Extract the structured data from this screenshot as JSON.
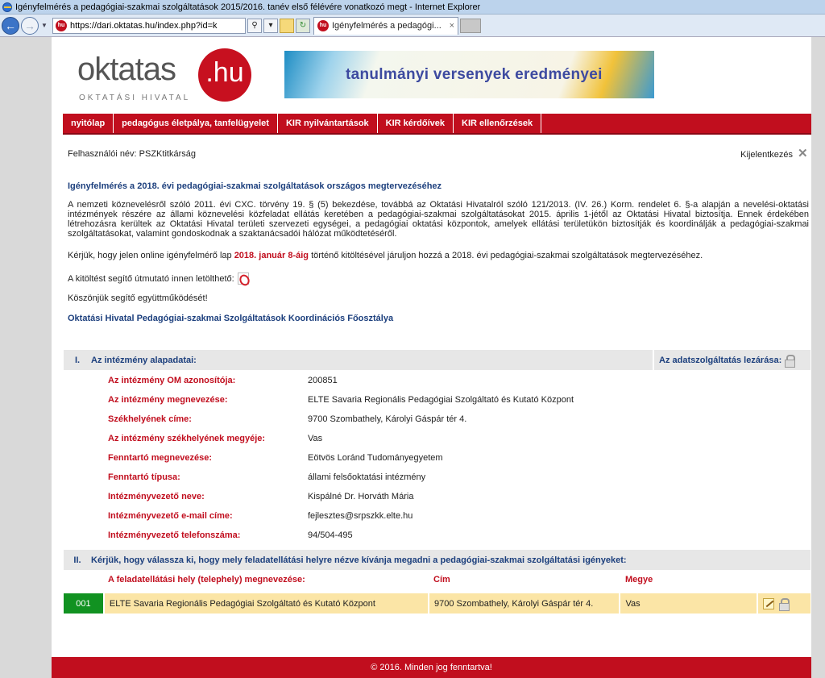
{
  "browser": {
    "window_title": "Igényfelmérés a pedagógiai-szakmai szolgáltatások 2015/2016. tanév első félévére vonatkozó megt - Internet Explorer",
    "url": "https://dari.oktatas.hu/index.php?id=k",
    "tab_title": "Igényfelmérés a pedagógi...",
    "favicon_text": "hu",
    "tab_close": "×"
  },
  "logo": {
    "word": "oktatas",
    "hu": ".hu",
    "subtitle": "OKTATÁSI HIVATAL"
  },
  "banner": {
    "text": "tanulmányi versenyek eredményei"
  },
  "menu": [
    {
      "label": "nyitólap"
    },
    {
      "label": "pedagógus életpálya, tanfelügyelet"
    },
    {
      "label": "KIR nyilvántartások"
    },
    {
      "label": "KIR kérdőívek"
    },
    {
      "label": "KIR ellenőrzések"
    }
  ],
  "user": {
    "label": "Felhasználói név: PSZKtitkárság",
    "logout": "Kijelentkezés"
  },
  "content": {
    "heading": "Igényfelmérés a 2018. évi pedagógiai-szakmai szolgáltatások országos megtervezéséhez",
    "para1": "A nemzeti köznevelésről szóló 2011. évi CXC. törvény 19. § (5) bekezdése, továbbá az Oktatási Hivatalról szóló 121/2013. (IV. 26.) Korm. rendelet 6. §-a alapján a nevelési-oktatási intézmények részére az állami köznevelési közfeladat ellátás keretében a pedagógiai-szakmai szolgáltatásokat 2015. április 1-jétől az Oktatási Hivatal biztosítja. Ennek érdekében létrehozásra kerültek az Oktatási Hivatal területi szervezeti egységei, a pedagógiai oktatási központok, amelyek ellátási területükön biztosítják és koordinálják a pedagógiai-szakmai szolgáltatásokat, valamint gondoskodnak a szaktanácsadói hálózat működtetéséről.",
    "para2_pre": "Kérjük, hogy jelen online igényfelmérő lap ",
    "para2_highlight": "2018. január 8-áig",
    "para2_post": " történő kitöltésével járuljon hozzá a 2018. évi pedagógiai-szakmai szolgáltatások megtervezéséhez.",
    "para3": "A kitöltést segítő útmutató innen letölthető:",
    "para4": "Köszönjük segítő együttműködését!",
    "signature": "Oktatási Hivatal Pedagógiai-szakmai Szolgáltatások Koordinációs Főosztálya"
  },
  "section1": {
    "num": "I.",
    "title": "Az intézmény alapadatai:",
    "right": "Az adatszolgáltatás lezárása:",
    "fields": [
      {
        "label": "Az intézmény OM azonosítója:",
        "value": "200851"
      },
      {
        "label": "Az intézmény megnevezése:",
        "value": "ELTE Savaria Regionális Pedagógiai Szolgáltató és Kutató Központ"
      },
      {
        "label": "Székhelyének címe:",
        "value": "9700 Szombathely, Károlyi Gáspár tér 4."
      },
      {
        "label": "Az intézmény székhelyének megyéje:",
        "value": "Vas"
      },
      {
        "label": "Fenntartó megnevezése:",
        "value": "Eötvös Loránd Tudományegyetem"
      },
      {
        "label": "Fenntartó típusa:",
        "value": "állami felsőoktatási intézmény"
      },
      {
        "label": "Intézményvezető neve:",
        "value": "Kispálné Dr. Horváth Mária"
      },
      {
        "label": "Intézményvezető e-mail címe:",
        "value": "fejlesztes@srpszkk.elte.hu"
      },
      {
        "label": "Intézményvezető telefonszáma:",
        "value": "94/504-495"
      }
    ]
  },
  "section2": {
    "num": "II.",
    "title": "Kérjük, hogy válassza ki, hogy mely feladatellátási helyre nézve kívánja megadni a pedagógiai-szakmai szolgáltatási igényeket:",
    "headers": {
      "name": "A feladatellátási hely (telephely) megnevezése:",
      "address": "Cím",
      "county": "Megye"
    },
    "rows": [
      {
        "code": "001",
        "name": "ELTE Savaria Regionális Pedagógiai Szolgáltató és Kutató Központ",
        "address": "9700 Szombathely, Károlyi Gáspár tér 4.",
        "county": "Vas"
      }
    ]
  },
  "footer": "© 2016. Minden jog fenntartva!",
  "icons": {
    "logout": "close-x-icon",
    "pdf": "pdf-icon",
    "lock": "padlock-icon",
    "edit": "edit-pencil-icon"
  },
  "colors": {
    "brand_red": "#c10e1e",
    "heading_blue": "#1c3f7d",
    "row_green": "#119221",
    "row_yellow": "#fbe5a6"
  }
}
